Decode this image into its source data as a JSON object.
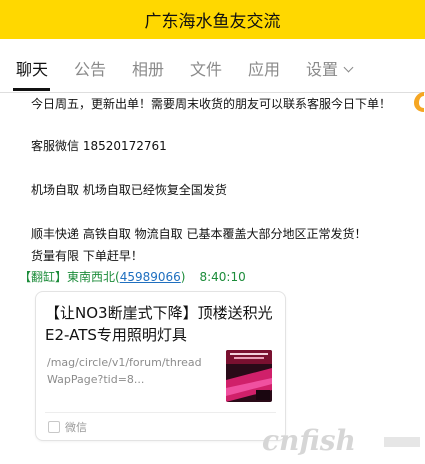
{
  "header": {
    "title": "广东海水鱼友交流"
  },
  "tabs": [
    {
      "label": "聊天"
    },
    {
      "label": "公告"
    },
    {
      "label": "相册"
    },
    {
      "label": "文件"
    },
    {
      "label": "应用"
    },
    {
      "label": "设置"
    }
  ],
  "messages": [
    "今日周五，更新出单！需要周末收货的朋友可以联系客服今日下单！",
    "客服微信 18520172761",
    "机场自取 机场自取已经恢复全国发货",
    "顺丰快递 高铁自取 物流自取 已基本覆盖大部分地区正常发货！",
    "货量有限  下单赶早！"
  ],
  "sender": {
    "nick": "【翻缸】東南西北(",
    "qq": "45989066",
    "close": ")",
    "time": "8:40:10"
  },
  "card": {
    "title": "【让NO3断崖式下降】顶楼送积光E2-ATS专用照明灯具",
    "url": "/mag/circle/v1/forum/threadWapPage?tid=8...",
    "source": "微信"
  },
  "watermark": {
    "text": "cnfish"
  },
  "colors": {
    "header_bg": "#ffd800",
    "sender_green": "#1c8c3a",
    "link_blue": "#1f6fbf"
  }
}
